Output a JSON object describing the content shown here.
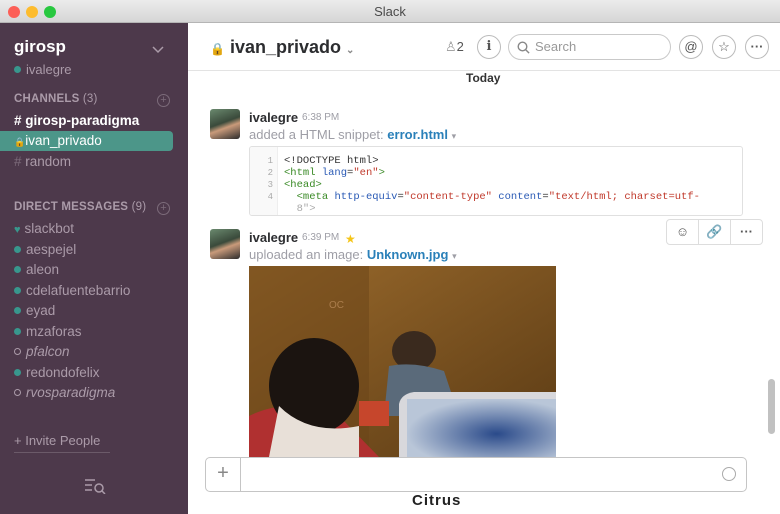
{
  "window": {
    "title": "Slack"
  },
  "sidebar": {
    "team_name": "girosp",
    "current_user": "ivalegre",
    "channels_heading": "CHANNELS",
    "channels_count": "(3)",
    "channels": [
      {
        "prefix": "#",
        "label": "girosp-paradigma"
      },
      {
        "prefix": "🔒",
        "label": "ivan_privado"
      },
      {
        "prefix": "#",
        "label": "random"
      }
    ],
    "dm_heading": "DIRECT MESSAGES",
    "dm_count": "(9)",
    "dms": [
      {
        "label": "slackbot",
        "status": "heart"
      },
      {
        "label": "aespejel",
        "status": "online"
      },
      {
        "label": "aleon",
        "status": "online"
      },
      {
        "label": "cdelafuentebarrio",
        "status": "online"
      },
      {
        "label": "eyad",
        "status": "online"
      },
      {
        "label": "mzaforas",
        "status": "online"
      },
      {
        "label": "pfalcon",
        "status": "away"
      },
      {
        "label": "redondofelix",
        "status": "online"
      },
      {
        "label": "rvosparadigma",
        "status": "away"
      }
    ],
    "invite_label": "+ Invite People"
  },
  "header": {
    "channel_name": "ivan_privado",
    "member_count": "2",
    "search_placeholder": "Search"
  },
  "messages": {
    "day_divider": "Today",
    "m1": {
      "user": "ivalegre",
      "time": "6:38 PM",
      "action": "added a HTML snippet:",
      "file": "error.html",
      "code_lines": [
        "1",
        "2",
        "3",
        "4"
      ]
    },
    "m2": {
      "user": "ivalegre",
      "time": "6:39 PM",
      "action": "uploaded an image:",
      "file": "Unknown.jpg"
    }
  },
  "colors": {
    "sidebar_bg": "#4d394b",
    "selected_channel": "#4c9689",
    "online": "#38978d",
    "link": "#2a80b9",
    "star": "#f5c518"
  },
  "background_text": "Citrus"
}
